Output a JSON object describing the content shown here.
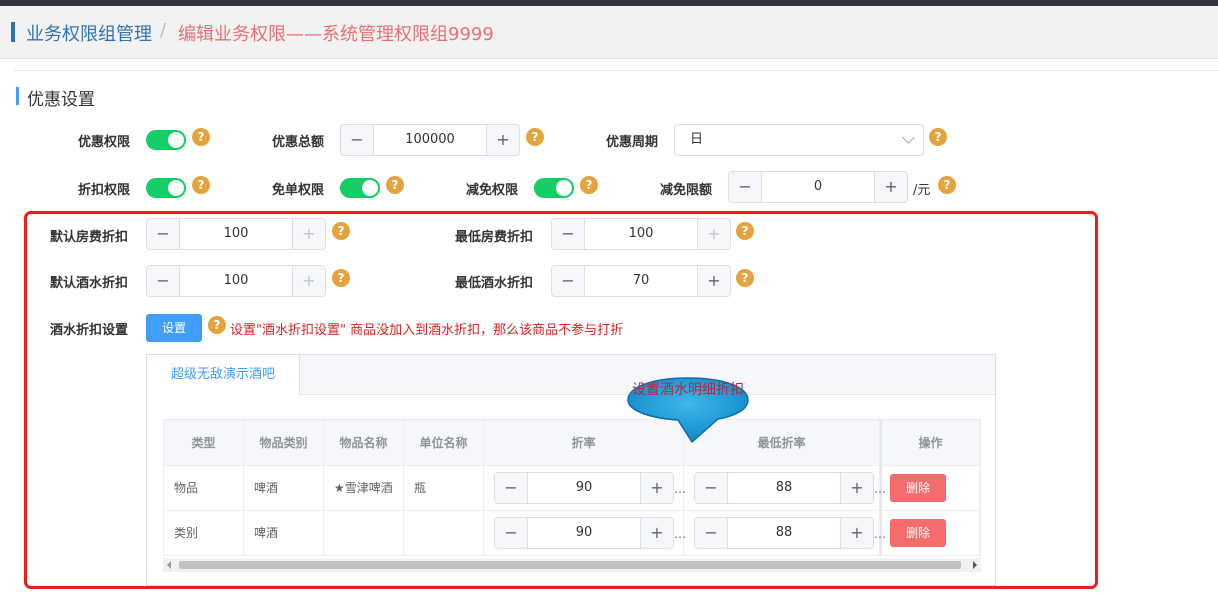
{
  "header": {
    "breadcrumb_parent": "业务权限组管理",
    "separator": "/",
    "breadcrumb_current": "编辑业务权限——系统管理权限组9999"
  },
  "section": {
    "title": "优惠设置"
  },
  "row1": {
    "discount_perm_label": "优惠权限",
    "discount_total_label": "优惠总额",
    "discount_total_value": "100000",
    "discount_period_label": "优惠周期",
    "discount_period_value": "日"
  },
  "row2": {
    "rebate_perm_label": "折扣权限",
    "free_order_label": "免单权限",
    "reduction_perm_label": "减免权限",
    "reduction_limit_label": "减免限额",
    "reduction_limit_value": "0",
    "reduction_limit_unit": "/元"
  },
  "discounts": {
    "default_room_label": "默认房费折扣",
    "default_room_value": "100",
    "min_room_label": "最低房费折扣",
    "min_room_value": "100",
    "default_drink_label": "默认酒水折扣",
    "default_drink_value": "100",
    "min_drink_label": "最低酒水折扣",
    "min_drink_value": "70",
    "drink_setting_label": "酒水折扣设置",
    "drink_setting_button": "设置",
    "drink_setting_warning": "设置\"酒水折扣设置\" 商品没加入到酒水折扣，那么该商品不参与打折"
  },
  "tabs": [
    {
      "label": "超级无敌演示酒吧"
    }
  ],
  "table": {
    "headers": [
      "类型",
      "物品类别",
      "物品名称",
      "单位名称",
      "折率",
      "最低折率",
      "操作"
    ],
    "rows": [
      {
        "type": "物品",
        "category": "啤酒",
        "name": "★雪津啤酒",
        "unit": "瓶",
        "rate": "90",
        "min_rate": "88",
        "action": "删除"
      },
      {
        "type": "类别",
        "category": "啤酒",
        "name": "",
        "unit": "",
        "rate": "90",
        "min_rate": "88",
        "action": "删除"
      }
    ]
  },
  "callout": {
    "text": "设置酒水明细折扣"
  },
  "icons": {
    "help": "question-circle-icon",
    "minus": "minus-icon",
    "plus": "plus-icon",
    "chevron": "chevron-down-icon"
  },
  "colors": {
    "accent": "#409eff",
    "switch_on": "#13ce66",
    "help": "#e6a23c",
    "danger": "#f56c6c",
    "annotation_box": "#f01c1c",
    "breadcrumb_current": "#ef6f6f"
  }
}
